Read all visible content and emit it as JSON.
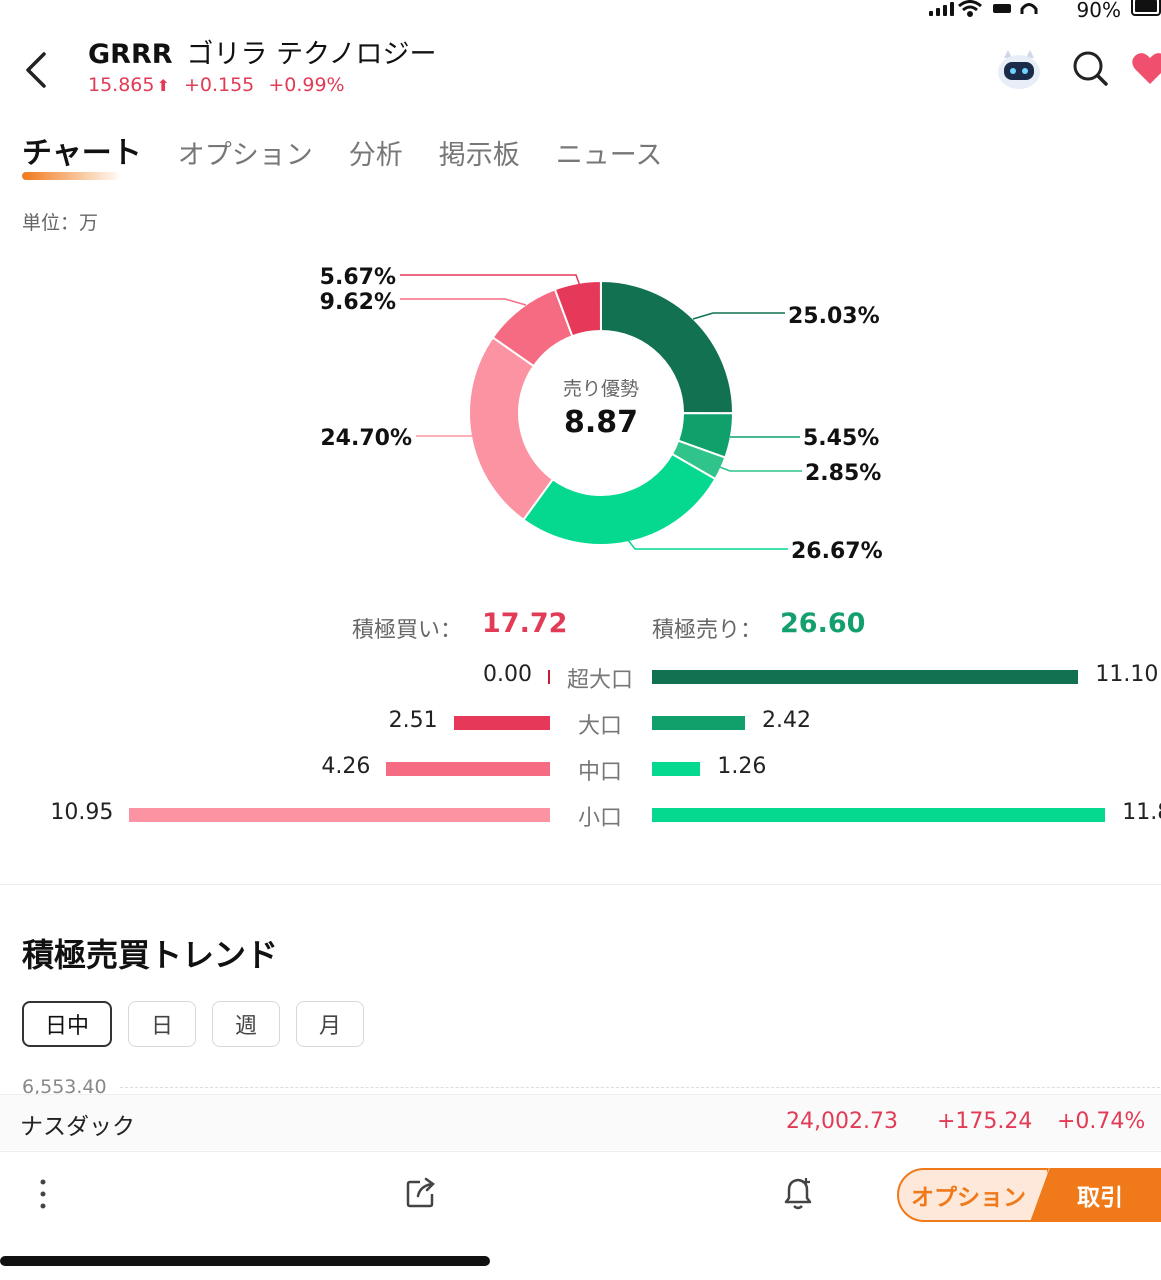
{
  "status": {
    "battery": "90%"
  },
  "header": {
    "ticker": "GRRR",
    "company": "ゴリラ テクノロジー",
    "price": "15.865",
    "change": "+0.155",
    "change_pct": "+0.99%",
    "icons": [
      "back-icon",
      "robot-assistant-icon",
      "search-icon",
      "heart-icon"
    ]
  },
  "tabs": [
    "チャート",
    "オプション",
    "分析",
    "掲示板",
    "ニュース"
  ],
  "unit": "単位：万",
  "donut": {
    "center_label": "売り優勢",
    "center_value": "8.87",
    "labels": {
      "sell_super": "25.03%",
      "sell_large": "5.45%",
      "sell_mid": "2.85%",
      "sell_small": "26.67%",
      "buy_small": "24.70%",
      "buy_mid": "9.62%",
      "buy_large": "5.67%"
    }
  },
  "chart_data": {
    "type": "pie",
    "center_label": "売り優勢",
    "center_value": 8.87,
    "series": [
      {
        "name": "超大口",
        "side": "sell",
        "percent": 25.03,
        "color": "#127150"
      },
      {
        "name": "大口",
        "side": "sell",
        "percent": 5.45,
        "color": "#0fa06c"
      },
      {
        "name": "中口",
        "side": "sell",
        "percent": 2.85,
        "color": "#30c48a"
      },
      {
        "name": "小口",
        "side": "sell",
        "percent": 26.67,
        "color": "#05d88f"
      },
      {
        "name": "小口",
        "side": "buy",
        "percent": 24.7,
        "color": "#fb93a3"
      },
      {
        "name": "中口",
        "side": "buy",
        "percent": 9.62,
        "color": "#f56b82"
      },
      {
        "name": "大口",
        "side": "buy",
        "percent": 5.67,
        "color": "#e6395a"
      },
      {
        "name": "超大口",
        "side": "buy",
        "percent": 0.0,
        "color": "#c41e3a"
      }
    ]
  },
  "totals": {
    "buy_label": "積極買い：",
    "buy_value": "17.72",
    "sell_label": "積極売り：",
    "sell_value": "26.60"
  },
  "flow_scale_max": 11.87,
  "flows": [
    {
      "category": "超大口",
      "buy": "0.00",
      "buy_num": 0.0,
      "sell": "11.10",
      "sell_num": 11.1,
      "buy_color": "#c41e3a",
      "sell_color": "#127150"
    },
    {
      "category": "大口",
      "buy": "2.51",
      "buy_num": 2.51,
      "sell": "2.42",
      "sell_num": 2.42,
      "buy_color": "#e6395a",
      "sell_color": "#0fa06c"
    },
    {
      "category": "中口",
      "buy": "4.26",
      "buy_num": 4.26,
      "sell": "1.26",
      "sell_num": 1.26,
      "buy_color": "#f56b82",
      "sell_color": "#05d88f"
    },
    {
      "category": "小口",
      "buy": "10.95",
      "buy_num": 10.95,
      "sell": "11.8",
      "sell_num": 11.8,
      "buy_color": "#fb93a3",
      "sell_color": "#05d88f"
    }
  ],
  "trend": {
    "title": "積極売買トレンド",
    "periods": [
      "日中",
      "日",
      "週",
      "月"
    ],
    "active_period": "日中",
    "y_tick": "6,553.40"
  },
  "index": {
    "name": "ナスダック",
    "value": "24,002.73",
    "change": "+175.24",
    "change_pct": "+0.74%"
  },
  "bottom": {
    "option_label": "オプション",
    "trade_label": "取引",
    "icons": [
      "more-vertical-icon",
      "share-icon",
      "alert-bell-icon"
    ]
  },
  "colors": {
    "up": "#e23b55",
    "down": "#14a06e",
    "accent": "#f07a1a"
  }
}
